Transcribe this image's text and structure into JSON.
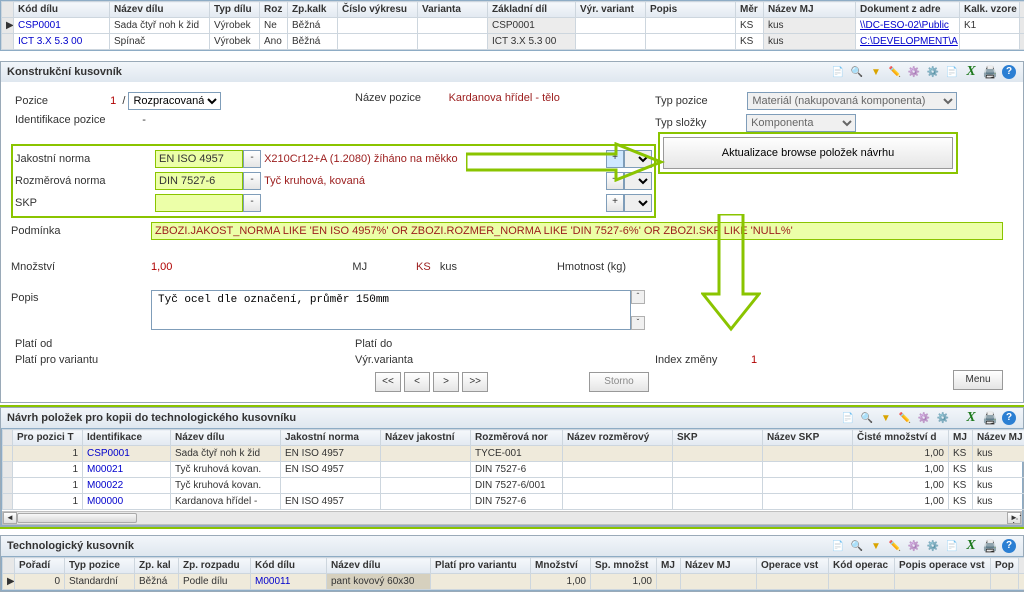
{
  "top_grid": {
    "headers": [
      "",
      "Kód dílu",
      "Název dílu",
      "Typ dílu",
      "Roz",
      "Zp.kalk",
      "Číslo výkresu",
      "Varianta",
      "Základní díl",
      "Výr. variant",
      "Popis",
      "Měr",
      "Název MJ",
      "Dokument z adre",
      "Kalk. vzore",
      ""
    ],
    "rows": [
      {
        "cursor": "▶",
        "kod": "CSP0001",
        "nazev": "Sada čtyř noh k žid",
        "typ": "Výrobek",
        "roz": "Ne",
        "zp": "Běžná",
        "cis": "",
        "var": "",
        "zakl": "CSP0001",
        "vyrv": "",
        "popis": "",
        "mer": "KS",
        "nazev_mj": "kus",
        "dok": "\\\\DC-ESO-02\\Public",
        "kalk": "K1",
        "sc": "ˆ"
      },
      {
        "cursor": "",
        "kod": "ICT 3.X 5.3 00",
        "nazev": "Spínač",
        "typ": "Výrobek",
        "roz": "Ano",
        "zp": "Běžná",
        "cis": "",
        "var": "",
        "zakl": "ICT 3.X 5.3 00",
        "vyrv": "",
        "popis": "",
        "mer": "KS",
        "nazev_mj": "kus",
        "dok": "C:\\DEVELOPMENT\\A",
        "kalk": "",
        "sc": "ˇ"
      }
    ]
  },
  "panel_kus": {
    "title": "Konstrukční kusovník",
    "pozice_lbl": "Pozice",
    "pozice_val": "1",
    "stav": "Rozpracovaná",
    "nazev_pozice_lbl": "Název pozice",
    "nazev_pozice_val": "Kardanova hřídel - tělo",
    "typ_pozice_lbl": "Typ pozice",
    "typ_pozice_val": "Materiál (nakupovaná komponenta)",
    "ident_lbl": "Identifikace pozice",
    "ident_val": "-",
    "typ_slozky_lbl": "Typ složky",
    "typ_slozky_val": "Komponenta",
    "jakost_lbl": "Jakostní norma",
    "jakost_code": "EN ISO 4957",
    "jakost_text": "X210Cr12+A (1.2080) žíháno na měkko",
    "rozmer_lbl": "Rozměrová norma",
    "rozmer_code": "DIN 7527-6",
    "rozmer_text": "Tyč kruhová, kovaná",
    "skp_lbl": "SKP",
    "skp_dash": "-",
    "podminka_lbl": "Podmínka",
    "podminka_val": "ZBOZI.JAKOST_NORMA  LIKE 'EN ISO 4957%'  OR ZBOZI.ROZMER_NORMA  LIKE 'DIN 7527-6%' OR ZBOZI.SKP  LIKE 'NULL%'",
    "update_btn": "Aktualizace browse položek návrhu",
    "mnozstvi_lbl": "Množství",
    "mnozstvi_val": "1,00",
    "mj_lbl": "MJ",
    "mj_code": "KS",
    "mj_name": "kus",
    "hmot_lbl": "Hmotnost (kg)",
    "popis_lbl": "Popis",
    "popis_val": "Tyč ocel dle označení, průměr 150mm",
    "plati_od_lbl": "Platí od",
    "plati_do_lbl": "Platí do",
    "plati_var_lbl": "Platí pro variantu",
    "vyr_var_lbl": "Výr.varianta",
    "index_lbl": "Index změny",
    "index_val": "1",
    "nav_first": "<<",
    "nav_prev": "<",
    "nav_next": ">",
    "nav_last": ">>",
    "nav_storno": "Storno",
    "nav_menu": "Menu"
  },
  "panel_navrh": {
    "title": "Návrh položek pro kopii do technologického kusovníku",
    "headers": [
      "",
      "Pro pozici T",
      "Identifikace",
      "Název dílu",
      "Jakostní norma",
      "Název jakostní",
      "Rozměrová nor",
      "Název rozměrový",
      "SKP",
      "Název SKP",
      "Čisté množství d",
      "MJ",
      "Název MJ",
      ""
    ],
    "rows": [
      {
        "poz": "1",
        "ident": "CSP0001",
        "nazev": "Sada čtyř noh k žid",
        "jak": "EN ISO 4957",
        "njak": "",
        "rozn": "TYCE-001",
        "nrozn": "",
        "skp": "",
        "nskp": "",
        "mn": "1,00",
        "mj": "KS",
        "nmj": "kus"
      },
      {
        "poz": "1",
        "ident": "M00021",
        "nazev": "Tyč kruhová kovan.",
        "jak": "EN ISO 4957",
        "njak": "",
        "rozn": "DIN 7527-6",
        "nrozn": "",
        "skp": "",
        "nskp": "",
        "mn": "1,00",
        "mj": "KS",
        "nmj": "kus"
      },
      {
        "poz": "1",
        "ident": "M00022",
        "nazev": "Tyč kruhová kovan.",
        "jak": "",
        "njak": "",
        "rozn": "DIN 7527-6/001",
        "nrozn": "",
        "skp": "",
        "nskp": "",
        "mn": "1,00",
        "mj": "KS",
        "nmj": "kus"
      },
      {
        "poz": "1",
        "ident": "M00000",
        "nazev": "Kardanova hřídel -",
        "jak": "EN ISO 4957",
        "njak": "",
        "rozn": "DIN 7527-6",
        "nrozn": "",
        "skp": "",
        "nskp": "",
        "mn": "1,00",
        "mj": "KS",
        "nmj": "kus"
      }
    ]
  },
  "panel_tech": {
    "title": "Technologický kusovník",
    "headers": [
      "",
      "Pořadí",
      "Typ pozice",
      "Zp. kal",
      "Zp. rozpadu",
      "Kód dílu",
      "Název dílu",
      "Platí pro variantu",
      "Množství",
      "Sp. množst",
      "MJ",
      "Název MJ",
      "Operace vst",
      "Kód operac",
      "Popis operace vst",
      "Pop",
      ""
    ],
    "rows": [
      {
        "cursor": "▶",
        "por": "0",
        "typ": "Standardní",
        "zpk": "Běžná",
        "zpr": "Podle dílu",
        "kod": "M00011",
        "nazev": "pant kovový 60x30",
        "var": "",
        "mn": "1,00",
        "spmn": "1,00",
        "mj": "",
        "nmj": "",
        "ov": "",
        "kop": "",
        "pop": "",
        "p2": ""
      }
    ]
  }
}
